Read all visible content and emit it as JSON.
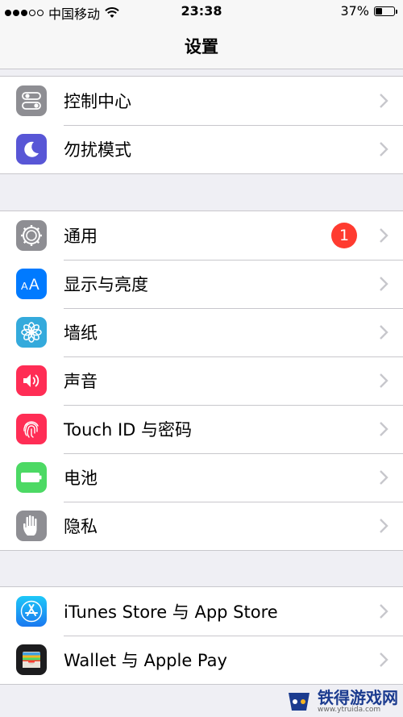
{
  "status_bar": {
    "carrier": "中国移动",
    "time": "23:38",
    "battery_percent": "37%",
    "battery_level": 0.37,
    "signal_dots_filled": 3,
    "signal_dots_total": 5
  },
  "nav": {
    "title": "设置"
  },
  "groups": [
    {
      "items": [
        {
          "label": "控制中心",
          "icon": "control-center-icon",
          "color": "#8e8e93"
        },
        {
          "label": "勿扰模式",
          "icon": "moon-icon",
          "color": "#5856d6"
        }
      ]
    },
    {
      "items": [
        {
          "label": "通用",
          "icon": "gear-icon",
          "color": "#8e8e93",
          "badge": "1"
        },
        {
          "label": "显示与亮度",
          "icon": "text-size-icon",
          "color": "#007aff"
        },
        {
          "label": "墙纸",
          "icon": "flower-icon",
          "color": "#34aadc"
        },
        {
          "label": "声音",
          "icon": "speaker-icon",
          "color": "#ff2d55"
        },
        {
          "label": "Touch ID 与密码",
          "icon": "fingerprint-icon",
          "color": "#ff2d55"
        },
        {
          "label": "电池",
          "icon": "battery-icon",
          "color": "#4cd964"
        },
        {
          "label": "隐私",
          "icon": "hand-icon",
          "color": "#8e8e93"
        }
      ]
    },
    {
      "items": [
        {
          "label": "iTunes Store 与 App Store",
          "icon": "app-store-icon",
          "color": "#1a8cf0"
        },
        {
          "label": "Wallet 与 Apple Pay",
          "icon": "wallet-icon",
          "color": "#1c1c1e"
        }
      ]
    }
  ],
  "watermark": {
    "text": "铁得游戏网",
    "url": "www.ytruida.com"
  }
}
